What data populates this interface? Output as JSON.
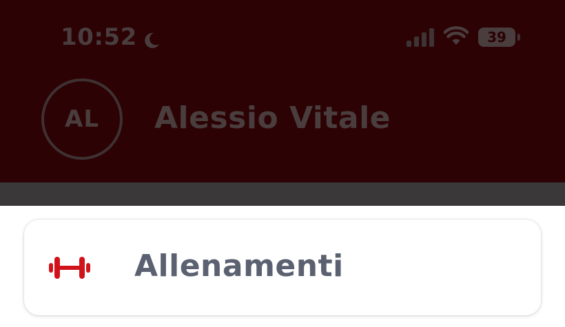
{
  "status_bar": {
    "time": "10:52",
    "battery_level": "39",
    "moon_icon": "moon-icon",
    "signal_icon": "cellular-signal-icon",
    "wifi_icon": "wifi-icon"
  },
  "profile": {
    "initials": "AL",
    "name": "Alessio Vitale"
  },
  "menu": {
    "items": [
      {
        "label": "Allenamenti",
        "icon": "dumbbell-icon"
      }
    ]
  },
  "colors": {
    "header_dimmed": "#2c0204",
    "accent_red": "#d0121b",
    "label_gray": "#5b6170"
  }
}
